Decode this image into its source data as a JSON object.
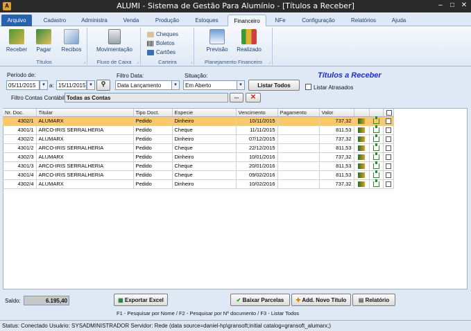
{
  "window": {
    "title": "ALUMI - Sistema de Gestão Para Alumínio - [Títulos a Receber]",
    "minimize": "–",
    "maximize": "□",
    "close": "✕"
  },
  "ribbon_tabs": [
    "Arquivo",
    "Cadastro",
    "Administra",
    "Venda",
    "Produção",
    "Estoques",
    "Financeiro",
    "NFe",
    "Configuração",
    "Relatórios",
    "Ajuda"
  ],
  "ribbon": {
    "titulos": {
      "label": "Títulos",
      "receber": "Receber",
      "pagar": "Pagar",
      "recibos": "Recibos"
    },
    "fluxo": {
      "label": "Fluxo de Caixa",
      "movimentacao": "Movimentação"
    },
    "carteira": {
      "label": "Carteira",
      "cheques": "Cheques",
      "boletos": "Boletos",
      "cartoes": "Cartões"
    },
    "planejamento": {
      "label": "Planejamento Financeiro",
      "previsao": "Previsão",
      "realizado": "Realizado"
    }
  },
  "filters": {
    "periodo_label": "Período de:",
    "date_from": "05/11/2015",
    "a_label": "a:",
    "date_to": "15/11/2015",
    "filtro_data_label": "Filtro Data:",
    "filtro_data_value": "Data Lançamento",
    "situacao_label": "Situação:",
    "situacao_value": "Em Aberto",
    "listar_todos": "Listar Todos",
    "listar_atrasados": "Listar Atrasados",
    "filtro_contas_label": "Filtro Contas Contábil:",
    "filtro_contas_value": "Todas as Contas",
    "ellipsis": "...",
    "headline": "Títulos a Receber"
  },
  "table": {
    "columns": [
      "Nr. Doc.",
      "Titular",
      "Tipo Doct.",
      "Especie",
      "Vencimento",
      "Pagamento",
      "Valor"
    ],
    "rows": [
      {
        "doc": "4302/1",
        "titular": "ALUMARX",
        "tipo": "Pedido",
        "especie": "Dinheiro",
        "venc": "10/11/2015",
        "pag": "",
        "valor": "737,32"
      },
      {
        "doc": "4301/1",
        "titular": "ARCO-IRIS SERRALHERIA",
        "tipo": "Pedido",
        "especie": "Cheque",
        "venc": "11/11/2015",
        "pag": "",
        "valor": "811,53"
      },
      {
        "doc": "4302/2",
        "titular": "ALUMARX",
        "tipo": "Pedido",
        "especie": "Dinheiro",
        "venc": "07/12/2015",
        "pag": "",
        "valor": "737,32"
      },
      {
        "doc": "4301/2",
        "titular": "ARCO-IRIS SERRALHERIA",
        "tipo": "Pedido",
        "especie": "Cheque",
        "venc": "22/12/2015",
        "pag": "",
        "valor": "811,53"
      },
      {
        "doc": "4302/3",
        "titular": "ALUMARX",
        "tipo": "Pedido",
        "especie": "Dinheiro",
        "venc": "10/01/2016",
        "pag": "",
        "valor": "737,32"
      },
      {
        "doc": "4301/3",
        "titular": "ARCO-IRIS SERRALHERIA",
        "tipo": "Pedido",
        "especie": "Cheque",
        "venc": "20/01/2016",
        "pag": "",
        "valor": "811,53"
      },
      {
        "doc": "4301/4",
        "titular": "ARCO-IRIS SERRALHERIA",
        "tipo": "Pedido",
        "especie": "Cheque",
        "venc": "09/02/2016",
        "pag": "",
        "valor": "811,53"
      },
      {
        "doc": "4302/4",
        "titular": "ALUMARX",
        "tipo": "Pedido",
        "especie": "Dinheiro",
        "venc": "10/02/2016",
        "pag": "",
        "valor": "737,32"
      }
    ]
  },
  "bottom": {
    "saldo_label": "Saldo:",
    "saldo_value": "6.195,40",
    "exportar": "Exportar Excel",
    "baixar": "Baixar Parcelas",
    "novo": "Add. Novo Título",
    "relatorio": "Relatório",
    "hint": "F1 - Pesquisar por Nome  /  F2 - Pesquisar por Nº documento  /  F3 - Listar Todos"
  },
  "status": {
    "text": "Status: Conectado   Usuário: SYSADMINISTRADOR   Servidor: Rede (data source=daniel-hp\\gransoft;initial catalog=gransoft_alumarx;)"
  },
  "colors": {
    "selected_row": "#fbc86a",
    "headline": "#1a2fd0",
    "file_tab": "#2b5fb0"
  }
}
